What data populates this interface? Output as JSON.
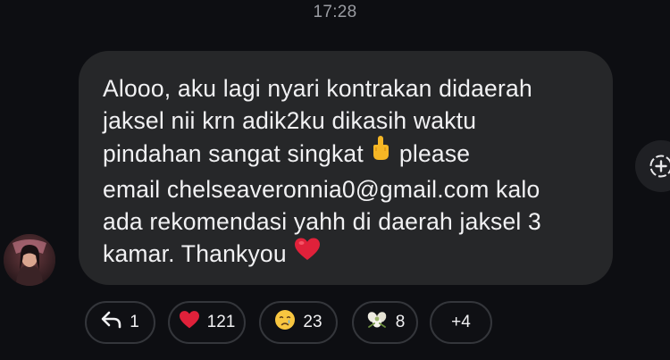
{
  "status": {
    "time": "17:28"
  },
  "message": {
    "lines": [
      "Alooo, aku lagi nyari kontrakan didaerah",
      "jaksel nii krn adik2ku dikasih waktu",
      "pindahan sangat singkat",
      "please",
      "email chelseaveronnia0@gmail.com kalo",
      "ada rekomendasi yahh di daerah jaksel 3",
      "kamar. Thankyou"
    ],
    "inline_emojis": [
      "middle-finger-emoji",
      "red-heart-emoji"
    ]
  },
  "reactions": {
    "reply_count": "1",
    "heart_count": "121",
    "cry_count": "23",
    "flower_count": "8",
    "more_label": "+4"
  },
  "colors": {
    "background": "#0d0e12",
    "bubble": "#262729",
    "text": "#f1f1f3",
    "heart": "#e0213a"
  }
}
